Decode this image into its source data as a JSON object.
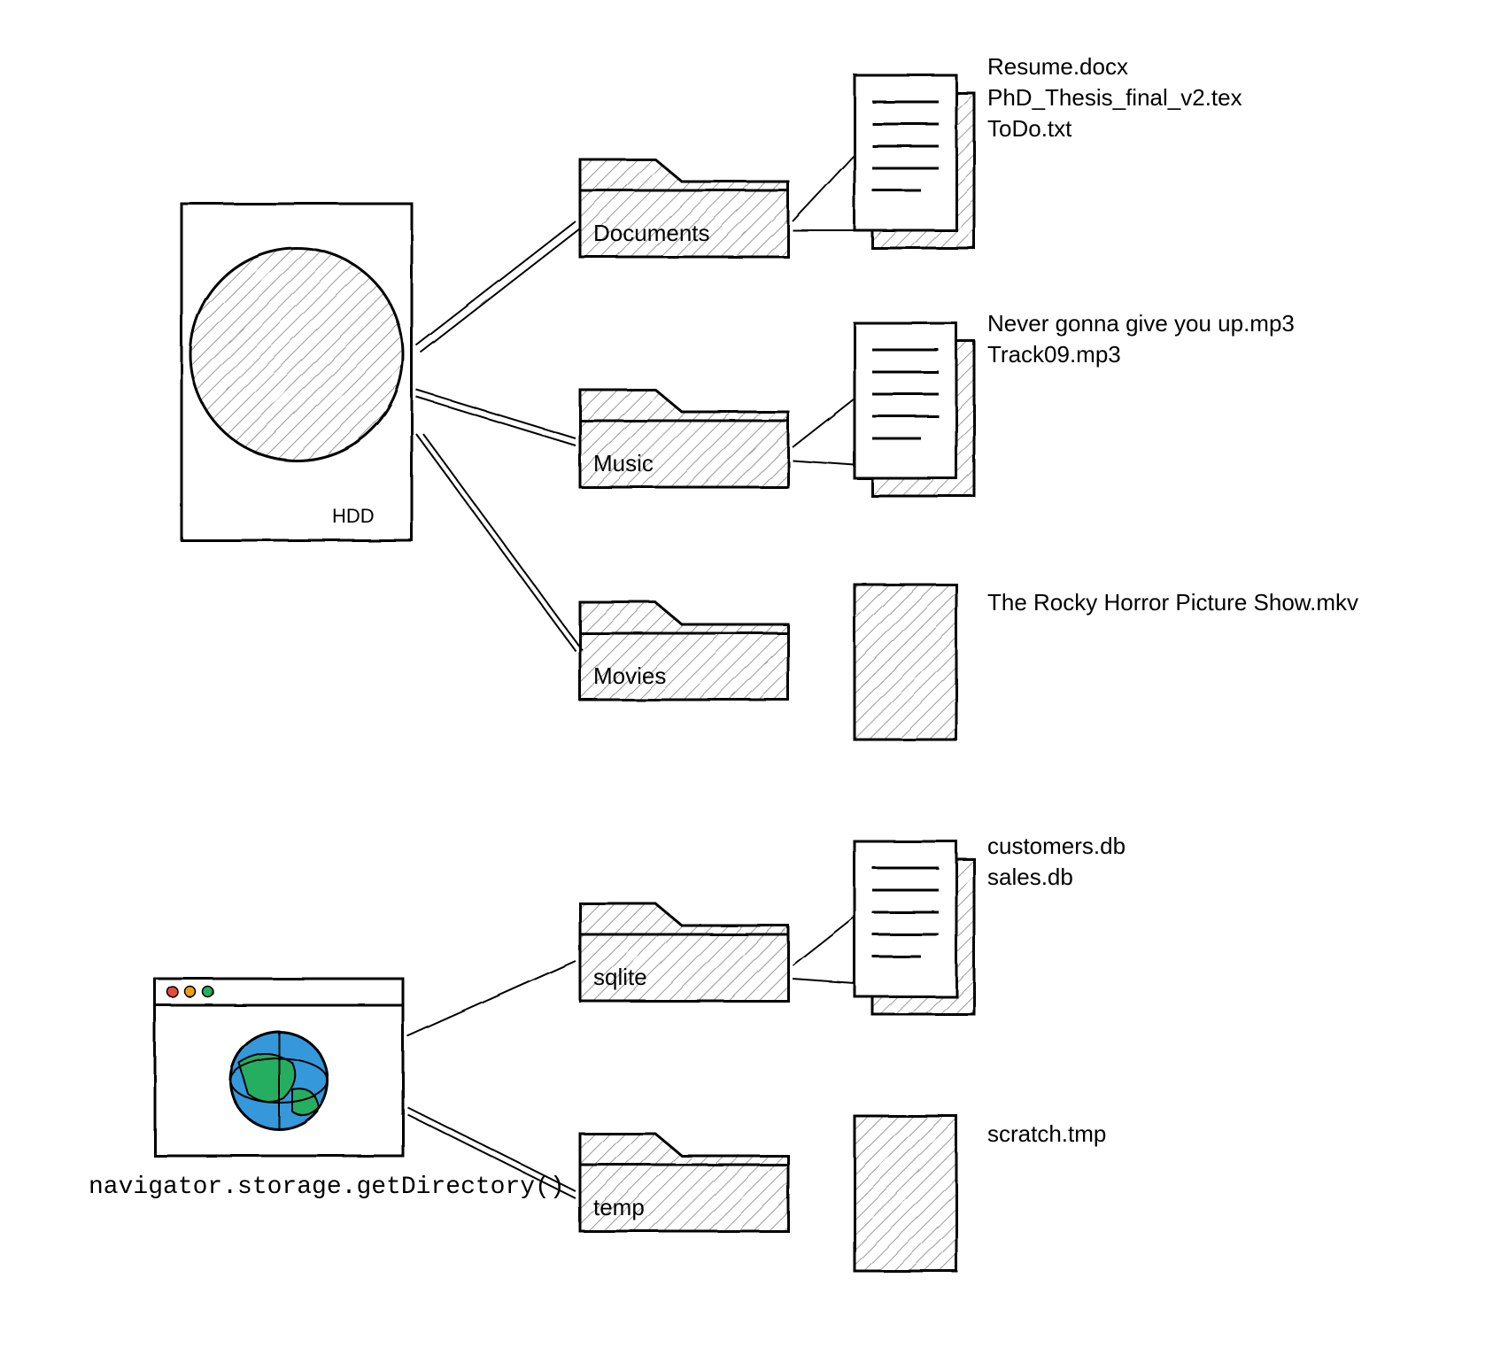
{
  "hdd": {
    "label": "HDD",
    "folders": [
      {
        "name": "Documents",
        "files": [
          "Resume.docx",
          "PhD_Thesis_final_v2.tex",
          "ToDo.txt"
        ]
      },
      {
        "name": "Music",
        "files": [
          "Never gonna give you up.mp3",
          "Track09.mp3"
        ]
      },
      {
        "name": "Movies",
        "files": [
          "The Rocky Horror Picture Show.mkv"
        ]
      }
    ]
  },
  "browser": {
    "api_label": "navigator.storage.getDirectory()",
    "folders": [
      {
        "name": "sqlite",
        "files": [
          "customers.db",
          "sales.db"
        ]
      },
      {
        "name": "temp",
        "files": [
          "scratch.tmp"
        ]
      }
    ]
  }
}
